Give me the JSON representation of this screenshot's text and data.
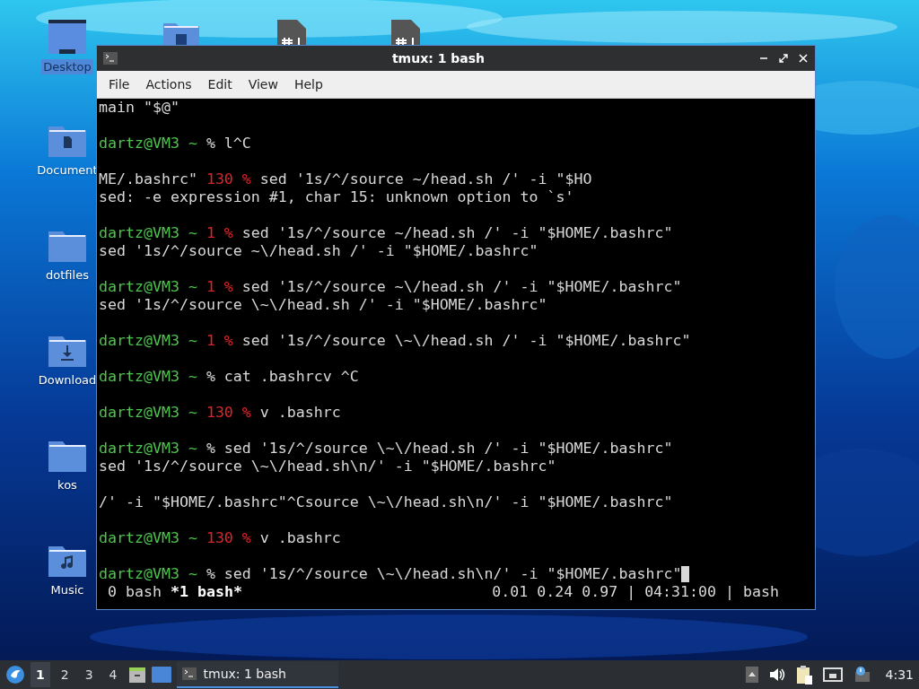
{
  "desktop_icons": [
    {
      "label": "Desktop",
      "kind": "desktop",
      "selected": true
    },
    {
      "label": "Document",
      "kind": "document",
      "selected": false
    },
    {
      "label": "dotfiles",
      "kind": "folder",
      "selected": false
    },
    {
      "label": "Download",
      "kind": "download",
      "selected": false
    },
    {
      "label": "kos",
      "kind": "folder",
      "selected": false
    },
    {
      "label": "Music",
      "kind": "music",
      "selected": false
    }
  ],
  "hidden_icons": [
    {
      "kind": "pictures"
    },
    {
      "kind": "script"
    },
    {
      "kind": "script"
    }
  ],
  "window": {
    "title": "tmux: 1 bash",
    "menu": [
      "File",
      "Actions",
      "Edit",
      "View",
      "Help"
    ],
    "lines": [
      {
        "segments": [
          {
            "kind": "plain",
            "text": "main \"$@\""
          }
        ]
      },
      {
        "kind": "blank"
      },
      {
        "segments": [
          {
            "kind": "prompt",
            "text": "dartz@VM3 ~ "
          },
          {
            "kind": "plain",
            "text": "% l^C"
          }
        ]
      },
      {
        "kind": "blank"
      },
      {
        "segments": [
          {
            "kind": "plain",
            "text": "ME/.bashrc\" "
          },
          {
            "kind": "error",
            "text": "130 % "
          },
          {
            "kind": "plain",
            "text": "sed '1s/^/source ~/head.sh /' -i \"$HO"
          }
        ]
      },
      {
        "segments": [
          {
            "kind": "plain",
            "text": "sed: -e expression #1, char 15: unknown option to `s'"
          }
        ]
      },
      {
        "kind": "blank"
      },
      {
        "segments": [
          {
            "kind": "prompt",
            "text": "dartz@VM3 ~ "
          },
          {
            "kind": "error",
            "text": "1 % "
          },
          {
            "kind": "plain",
            "text": "sed '1s/^/source ~/head.sh /' -i \"$HOME/.bashrc\""
          }
        ]
      },
      {
        "segments": [
          {
            "kind": "plain",
            "text": "sed '1s/^/source ~\\/head.sh /' -i \"$HOME/.bashrc\""
          }
        ]
      },
      {
        "kind": "blank"
      },
      {
        "segments": [
          {
            "kind": "prompt",
            "text": "dartz@VM3 ~ "
          },
          {
            "kind": "error",
            "text": "1 % "
          },
          {
            "kind": "plain",
            "text": "sed '1s/^/source ~\\/head.sh /' -i \"$HOME/.bashrc\""
          }
        ]
      },
      {
        "segments": [
          {
            "kind": "plain",
            "text": "sed '1s/^/source \\~\\/head.sh /' -i \"$HOME/.bashrc\""
          }
        ]
      },
      {
        "kind": "blank"
      },
      {
        "segments": [
          {
            "kind": "prompt",
            "text": "dartz@VM3 ~ "
          },
          {
            "kind": "error",
            "text": "1 % "
          },
          {
            "kind": "plain",
            "text": "sed '1s/^/source \\~\\/head.sh /' -i \"$HOME/.bashrc\""
          }
        ]
      },
      {
        "kind": "blank"
      },
      {
        "segments": [
          {
            "kind": "prompt",
            "text": "dartz@VM3 ~ "
          },
          {
            "kind": "plain",
            "text": "% cat .bashrcv ^C"
          }
        ]
      },
      {
        "kind": "blank"
      },
      {
        "segments": [
          {
            "kind": "prompt",
            "text": "dartz@VM3 ~ "
          },
          {
            "kind": "error",
            "text": "130 % "
          },
          {
            "kind": "plain",
            "text": "v .bashrc"
          }
        ]
      },
      {
        "kind": "blank"
      },
      {
        "segments": [
          {
            "kind": "prompt",
            "text": "dartz@VM3 ~ "
          },
          {
            "kind": "plain",
            "text": "% sed '1s/^/source \\~\\/head.sh /' -i \"$HOME/.bashrc\""
          }
        ]
      },
      {
        "segments": [
          {
            "kind": "plain",
            "text": "sed '1s/^/source \\~\\/head.sh\\n/' -i \"$HOME/.bashrc\""
          }
        ]
      },
      {
        "kind": "blank"
      },
      {
        "segments": [
          {
            "kind": "plain",
            "text": "/' -i \"$HOME/.bashrc\"^Csource \\~\\/head.sh\\n/' -i \"$HOME/.bashrc\""
          }
        ]
      },
      {
        "kind": "blank"
      },
      {
        "segments": [
          {
            "kind": "prompt",
            "text": "dartz@VM3 ~ "
          },
          {
            "kind": "error",
            "text": "130 % "
          },
          {
            "kind": "plain",
            "text": "v .bashrc"
          }
        ]
      },
      {
        "kind": "blank"
      },
      {
        "segments": [
          {
            "kind": "prompt",
            "text": "dartz@VM3 ~ "
          },
          {
            "kind": "plain",
            "text": "% sed '1s/^/source \\~\\/head.sh\\n/' -i \"$HOME/.bashrc\""
          }
        ],
        "cursor": true
      }
    ],
    "tmux_windows": [
      {
        "label": "0 bash",
        "selected": false
      },
      {
        "label": "*1 bash*",
        "selected": true
      }
    ],
    "tmux_status": "0.01 0.24 0.97 | 04:31:00 | bash"
  },
  "taskbar": {
    "workspaces": [
      {
        "label": "1",
        "selected": true
      },
      {
        "label": "2",
        "selected": false
      },
      {
        "label": "3",
        "selected": false
      },
      {
        "label": "4",
        "selected": false
      }
    ],
    "task": {
      "label": "tmux: 1 bash",
      "selected": true
    },
    "clock": "4:31"
  }
}
